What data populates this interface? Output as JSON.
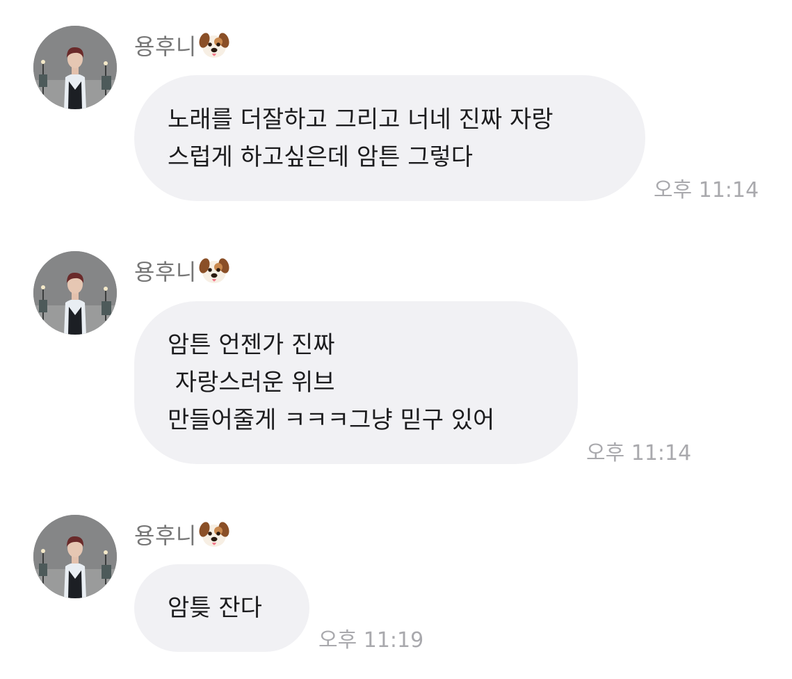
{
  "messages": [
    {
      "sender": "용후니",
      "sender_emoji_icon": "dog-face-icon",
      "lines": [
        "노래를 더잘하고 그리고 너네 진짜 자랑",
        "스럽게 하고싶은데 암튼 그렇다"
      ],
      "time": "오후 11:14"
    },
    {
      "sender": "용후니",
      "sender_emoji_icon": "dog-face-icon",
      "lines": [
        "암튼 언젠가 진짜",
        " 자랑스러운 위브",
        "만들어줄게 ㅋㅋㅋ그냥 믿구 있어"
      ],
      "time": "오후 11:14"
    },
    {
      "sender": "용후니",
      "sender_emoji_icon": "dog-face-icon",
      "lines": [
        "암틎 잔다"
      ],
      "time": "오후 11:19"
    }
  ],
  "colors": {
    "bubble": "#f1f1f4",
    "sender_text": "#767676",
    "time_text": "#a9a9ad",
    "message_text": "#1c1c1e"
  }
}
